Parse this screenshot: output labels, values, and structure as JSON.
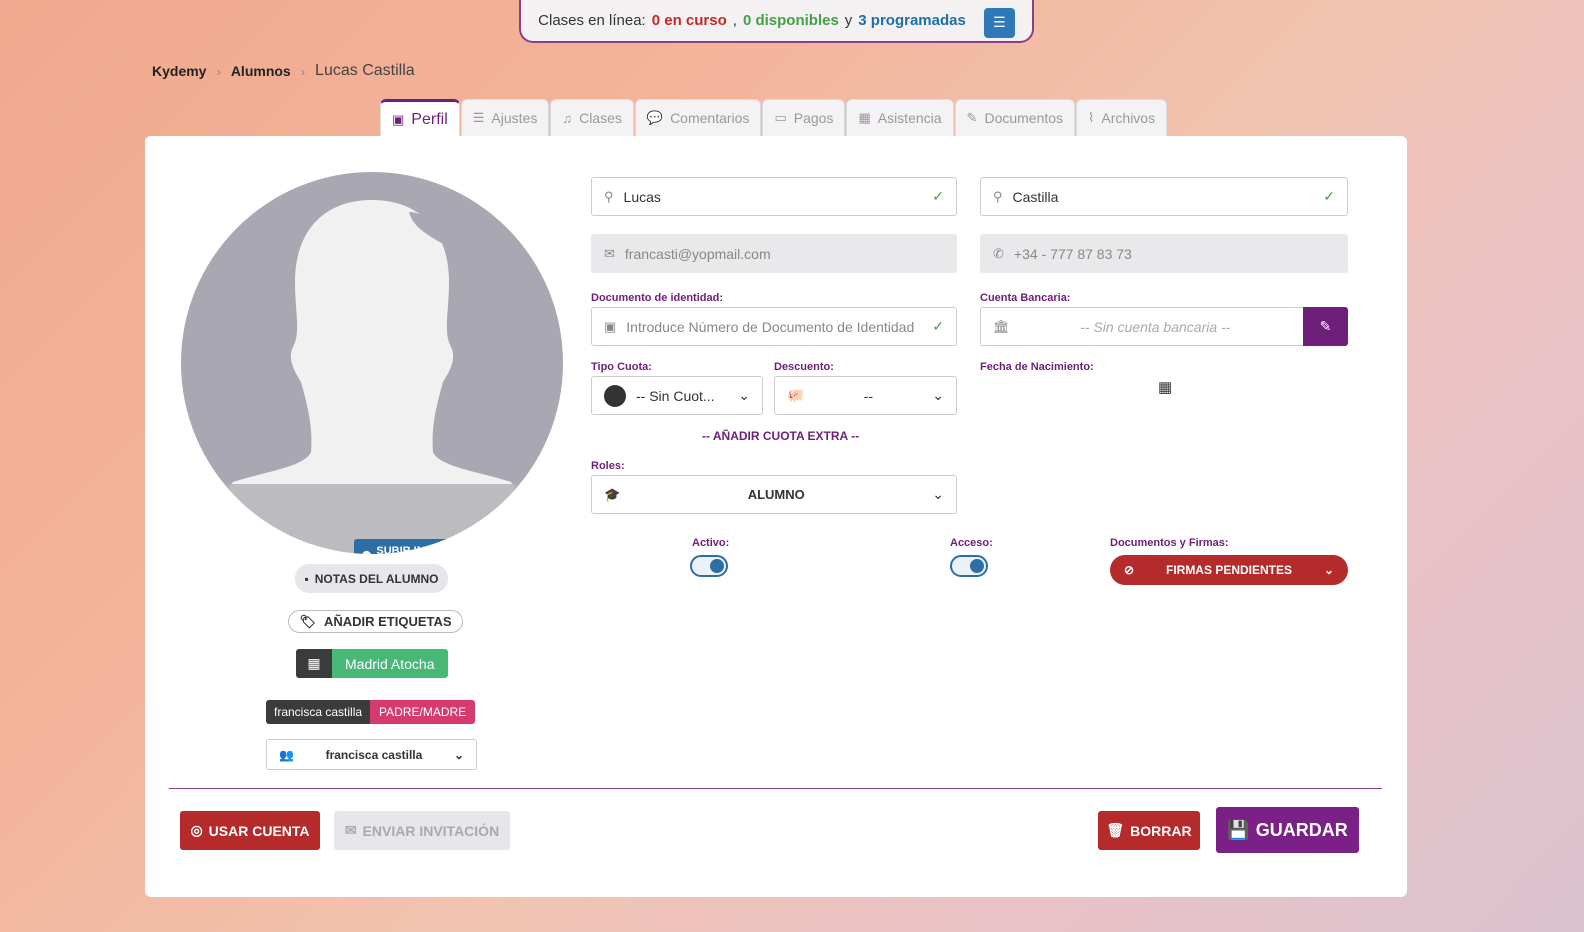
{
  "banner": {
    "prefix": "Clases en línea:",
    "in_progress": "0 en curso",
    "comma": ",",
    "available": "0 disponibles",
    "and": "y",
    "scheduled": "3 programadas",
    "list_icon": "☰"
  },
  "breadcrumb": {
    "items": [
      "Kydemy",
      "Alumnos"
    ],
    "current": "Lucas Castilla"
  },
  "tabs": [
    {
      "label": "Perfil",
      "icon": "id-card-icon",
      "glyph": "▣"
    },
    {
      "label": "Ajustes",
      "icon": "sliders-icon",
      "glyph": "☰"
    },
    {
      "label": "Clases",
      "icon": "music-icon",
      "glyph": "♫"
    },
    {
      "label": "Comentarios",
      "icon": "comments-icon",
      "glyph": "💬"
    },
    {
      "label": "Pagos",
      "icon": "money-icon",
      "glyph": "▭"
    },
    {
      "label": "Asistencia",
      "icon": "calendar-check-icon",
      "glyph": "▦"
    },
    {
      "label": "Documentos",
      "icon": "file-signature-icon",
      "glyph": "✎"
    },
    {
      "label": "Archivos",
      "icon": "paperclip-icon",
      "glyph": "⌇"
    }
  ],
  "profile": {
    "upload_label": "SUBIR IMAGEN",
    "notes_label": "NOTAS DEL ALUMNO",
    "tags_label": "AÑADIR ETIQUETAS",
    "center": "Madrid Atocha",
    "parent_name": "francisca castilla",
    "parent_role": "PADRE/MADRE",
    "parent_select": "francisca castilla"
  },
  "form": {
    "first_name": "Lucas",
    "last_name": "Castilla",
    "email": "francasti@yopmail.com",
    "phone": "+34 - 777 87 83 73",
    "id_label": "Documento de identidad:",
    "id_placeholder": "Introduce Número de Documento de Identidad",
    "bank_label": "Cuenta Bancaria:",
    "bank_value": "-- Sin cuenta bancaria --",
    "fee_label": "Tipo Cuota:",
    "fee_value": "-- Sin Cuot...",
    "discount_label": "Descuento:",
    "discount_value": "--",
    "birth_label": "Fecha de Nacimiento:",
    "extra_fee": "-- AÑADIR CUOTA EXTRA --",
    "roles_label": "Roles:",
    "roles_value": "ALUMNO",
    "active_label": "Activo:",
    "access_label": "Acceso:",
    "docs_label": "Documentos y Firmas:",
    "docs_value": "FIRMAS PENDIENTES",
    "active_on": true,
    "access_on": true
  },
  "actions": {
    "use_account": "USAR CUENTA",
    "send_invite": "ENVIAR INVITACIÓN",
    "delete": "BORRAR",
    "save": "GUARDAR"
  },
  "colors": {
    "brand": "#6d1f7a",
    "danger": "#b52a2a",
    "success": "#43a047",
    "info": "#2d6fa5"
  }
}
